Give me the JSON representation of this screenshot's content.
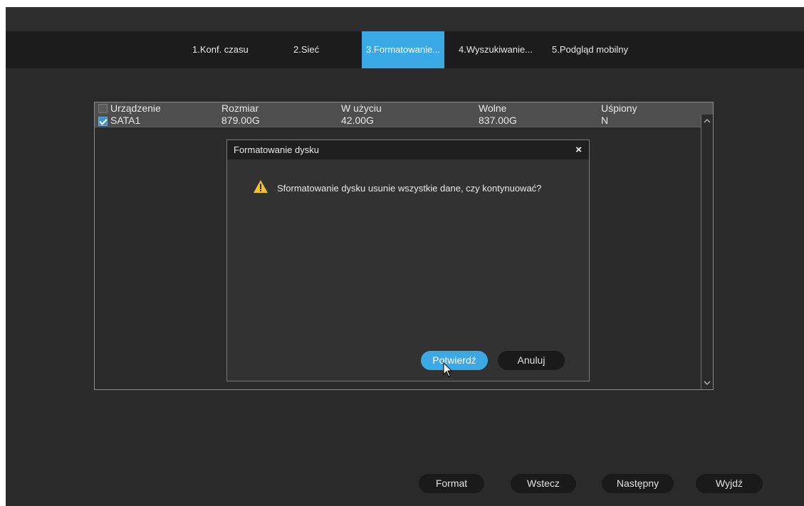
{
  "wizard": {
    "tabs": [
      {
        "label": "1.Konf. czasu",
        "active": false
      },
      {
        "label": "2.Sieć",
        "active": false
      },
      {
        "label": "3.Formatowanie...",
        "active": true
      },
      {
        "label": "4.Wyszukiwanie...",
        "active": false
      },
      {
        "label": "5.Podgląd mobilny",
        "active": false
      }
    ]
  },
  "disk_table": {
    "columns": [
      "Urządzenie",
      "Rozmiar",
      "W użyciu",
      "Wolne",
      "Uśpiony"
    ],
    "header_checked": false,
    "rows": [
      {
        "checked": true,
        "device": "SATA1",
        "size": "879.00G",
        "used": "42.00G",
        "free": "837.00G",
        "sleeping": "N"
      }
    ]
  },
  "dialog": {
    "title": "Formatowanie dysku",
    "close_symbol": "×",
    "icon": "warning-icon",
    "message": "Sformatowanie dysku usunie wszystkie dane, czy kontynuować?",
    "confirm_label": "Potwierdź",
    "cancel_label": "Anuluj"
  },
  "footer": {
    "format_label": "Format",
    "back_label": "Wstecz",
    "next_label": "Następny",
    "exit_label": "Wyjdź"
  },
  "colors": {
    "accent": "#3aa9e6",
    "background": "#2a2a2a",
    "tabbar": "#1c1c1c",
    "warning": "#f2c12e"
  }
}
